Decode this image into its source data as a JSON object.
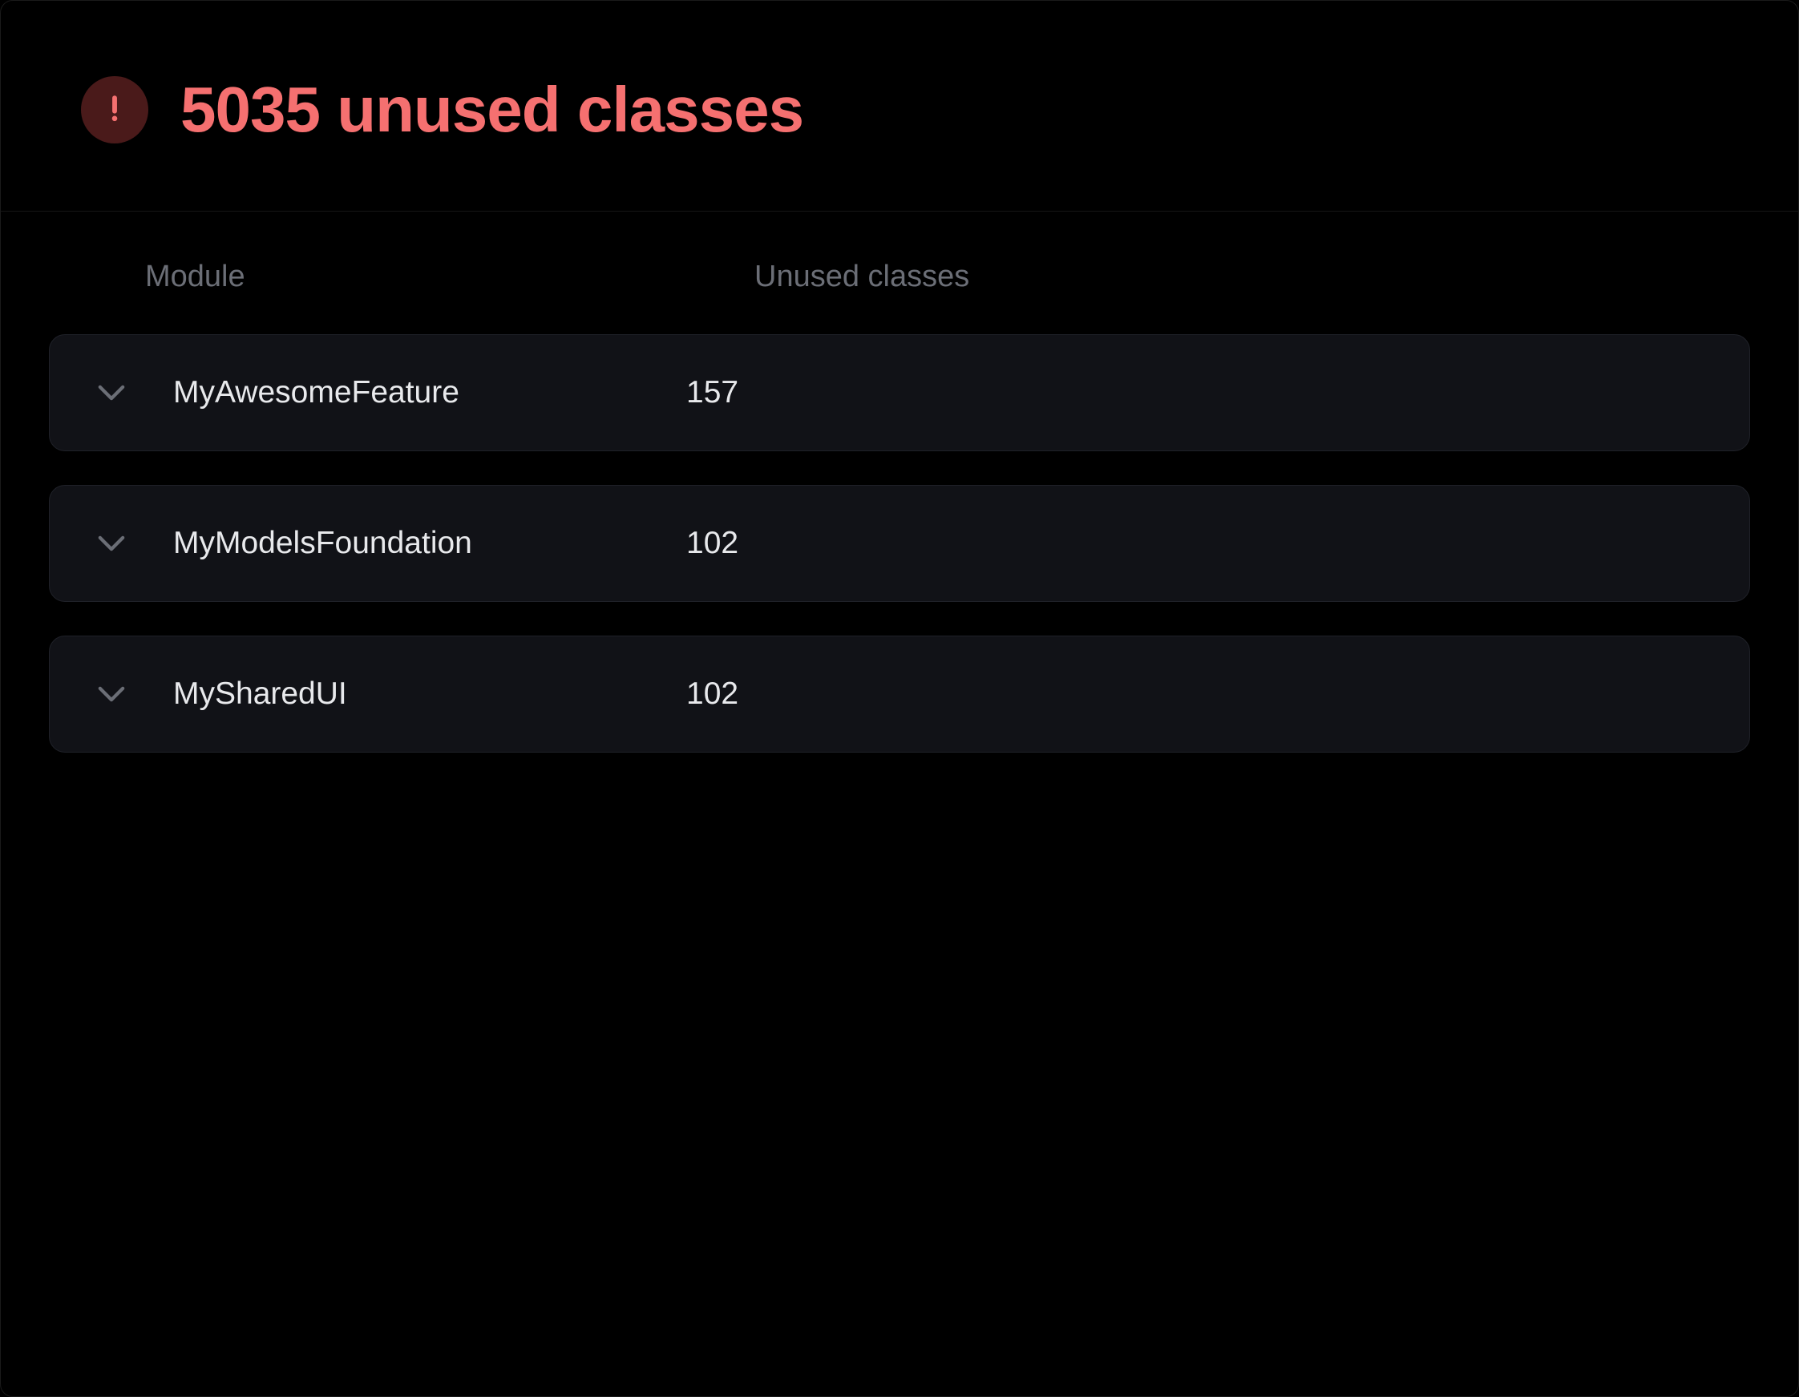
{
  "header": {
    "title": "5035 unused classes",
    "icon": "warning-icon"
  },
  "table": {
    "columns": {
      "module": "Module",
      "unused": "Unused classes"
    },
    "rows": [
      {
        "module": "MyAwesomeFeature",
        "count": "157"
      },
      {
        "module": "MyModelsFoundation",
        "count": "102"
      },
      {
        "module": "MySharedUI",
        "count": "102"
      }
    ]
  },
  "colors": {
    "accent": "#f57070",
    "iconBg": "#4a1a1a",
    "rowBg": "#111217",
    "rowBorder": "#1f2128",
    "textMuted": "#6b6e76",
    "textPrimary": "#e8e9ec"
  }
}
